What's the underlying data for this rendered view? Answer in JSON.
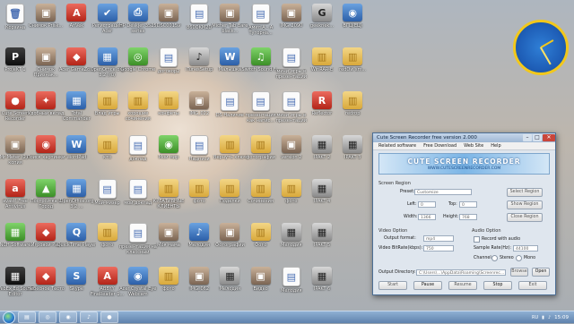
{
  "desktop": {
    "icons": [
      {
        "label": "Корзина",
        "glyph": "🗑",
        "kind": "doc",
        "col": 0,
        "row": 0
      },
      {
        "label": "Снимок Prisk...",
        "glyph": "▣",
        "kind": "photo",
        "col": 1,
        "row": 0
      },
      {
        "label": "AnVek",
        "glyph": "A",
        "kind": "red",
        "col": 2,
        "row": 0
      },
      {
        "label": "Регистрация Acer",
        "glyph": "✔",
        "kind": "app",
        "col": 3,
        "row": 0
      },
      {
        "label": "HP Deskjet 3525 series",
        "glyph": "⎙",
        "kind": "app",
        "col": 4,
        "row": 0
      },
      {
        "label": "DSC00159",
        "glyph": "▣",
        "kind": "photo",
        "col": 5,
        "row": 0
      },
      {
        "label": "860OKM2D",
        "glyph": "▤",
        "kind": "doc",
        "col": 6,
        "row": 0
      },
      {
        "label": "Micher Tab Bare black...",
        "glyph": "▣",
        "kind": "photo",
        "col": 7,
        "row": 0
      },
      {
        "label": "Амил А - A Туторна...",
        "glyph": "▤",
        "kind": "doc",
        "col": 8,
        "row": 0
      },
      {
        "label": "IMG_2090",
        "glyph": "▣",
        "kind": "photo",
        "col": 9,
        "row": 0
      },
      {
        "label": "geeknek...",
        "glyph": "G",
        "kind": "film",
        "col": 10,
        "row": 0
      },
      {
        "label": "ВГЦ(ЕЦ)",
        "glyph": "◉",
        "kind": "app",
        "col": 11,
        "row": 0
      },
      {
        "label": "ProjeKT 1",
        "glyph": "P",
        "kind": "dark",
        "col": 0,
        "row": 1
      },
      {
        "label": "Снимок Признак...",
        "glyph": "▣",
        "kind": "photo",
        "col": 1,
        "row": 1
      },
      {
        "label": "Acer GameZo...",
        "glyph": "◆",
        "kind": "red",
        "col": 2,
        "row": 1
      },
      {
        "label": "OpenOffice.org 3.2 (ru)",
        "glyph": "▦",
        "kind": "app",
        "col": 3,
        "row": 1
      },
      {
        "label": "Google Chrome",
        "glyph": "◎",
        "kind": "green",
        "col": 4,
        "row": 1
      },
      {
        "label": "договор2",
        "glyph": "▤",
        "kind": "doc",
        "col": 5,
        "row": 1
      },
      {
        "label": "iTunesSetup",
        "glyph": "♪",
        "kind": "film",
        "col": 6,
        "row": 1
      },
      {
        "label": "Малышка",
        "glyph": "W",
        "kind": "app",
        "col": 7,
        "row": 1
      },
      {
        "label": "Switch Sound F...",
        "glyph": "♫",
        "kind": "green",
        "col": 8,
        "row": 1
      },
      {
        "label": "мини игры в презентации",
        "glyph": "▤",
        "kind": "doc",
        "col": 9,
        "row": 1
      },
      {
        "label": "WinRAR-E",
        "glyph": "▥",
        "kind": "folder",
        "col": 10,
        "row": 1
      },
      {
        "label": "redOw sm...",
        "glyph": "▥",
        "kind": "folder",
        "col": 11,
        "row": 1
      },
      {
        "label": "Cute Screen Recorder",
        "glyph": "●",
        "kind": "red",
        "col": 0,
        "row": 2
      },
      {
        "label": "Удобный вклад",
        "glyph": "✦",
        "kind": "red",
        "col": 1,
        "row": 2
      },
      {
        "label": "Total Commander",
        "glyph": "▦",
        "kind": "app",
        "col": 2,
        "row": 2
      },
      {
        "label": "Влад игры",
        "glyph": "▥",
        "kind": "folder",
        "col": 3,
        "row": 2
      },
      {
        "label": "хорошие сочинения",
        "glyph": "▥",
        "kind": "folder",
        "col": 4,
        "row": 2
      },
      {
        "label": "конфеты",
        "glyph": "▥",
        "kind": "folder",
        "col": 5,
        "row": 2
      },
      {
        "label": "IMG_022",
        "glyph": "▣",
        "kind": "photo",
        "col": 6,
        "row": 2
      },
      {
        "label": "DS Наличие",
        "glyph": "▤",
        "kind": "doc",
        "col": 7,
        "row": 2
      },
      {
        "label": "презентация как напис...",
        "glyph": "▤",
        "kind": "doc",
        "col": 8,
        "row": 2
      },
      {
        "label": "мини игры в презентации",
        "glyph": "▤",
        "kind": "doc",
        "col": 9,
        "row": 2
      },
      {
        "label": "Reflector",
        "glyph": "R",
        "kind": "red",
        "col": 10,
        "row": 2
      },
      {
        "label": "redrop",
        "glyph": "▥",
        "kind": "folder",
        "col": 11,
        "row": 2
      },
      {
        "label": "Mr Meter (2) - копия",
        "glyph": "▣",
        "kind": "photo",
        "col": 0,
        "row": 3
      },
      {
        "label": "Поиск картинки",
        "glyph": "◉",
        "kind": "red",
        "col": 1,
        "row": 3
      },
      {
        "label": "WordPad",
        "glyph": "W",
        "kind": "app",
        "col": 2,
        "row": 3
      },
      {
        "label": "кто",
        "glyph": "▥",
        "kind": "folder",
        "col": 3,
        "row": 3
      },
      {
        "label": "доклад",
        "glyph": "▤",
        "kind": "doc",
        "col": 4,
        "row": 3
      },
      {
        "label": "Мой мир",
        "glyph": "◉",
        "kind": "green",
        "col": 5,
        "row": 3
      },
      {
        "label": "Надписи",
        "glyph": "▤",
        "kind": "doc",
        "col": 6,
        "row": 3
      },
      {
        "label": "Вернуть ключ",
        "glyph": "▥",
        "kind": "folder",
        "col": 7,
        "row": 3
      },
      {
        "label": "фотографии",
        "glyph": "▥",
        "kind": "folder",
        "col": 8,
        "row": 3
      },
      {
        "label": "version 2",
        "glyph": "▣",
        "kind": "photo",
        "col": 9,
        "row": 3
      },
      {
        "label": "IPAKT 2",
        "glyph": "▦",
        "kind": "film",
        "col": 10,
        "row": 3
      },
      {
        "label": "IPAKT 3",
        "glyph": "▦",
        "kind": "film",
        "col": 11,
        "row": 3
      },
      {
        "label": "avast! Free Antivirus",
        "glyph": "a",
        "kind": "red",
        "col": 0,
        "row": 4
      },
      {
        "label": "Построй-ка 2 Город",
        "glyph": "▲",
        "kind": "green",
        "col": 1,
        "row": 4
      },
      {
        "label": "OpenOffice.org 3.2 ...",
        "glyph": "▦",
        "kind": "app",
        "col": 2,
        "row": 4
      },
      {
        "label": "Мой-мизер",
        "glyph": "▤",
        "kind": "doc",
        "col": 3,
        "row": 4
      },
      {
        "label": "мой доклад",
        "glyph": "▤",
        "kind": "doc",
        "col": 4,
        "row": 4
      },
      {
        "label": "КРЕАТИВНЫЕ КЛИЕНТЫ",
        "glyph": "▥",
        "kind": "folder",
        "col": 5,
        "row": 4
      },
      {
        "label": "фото",
        "glyph": "▥",
        "kind": "folder",
        "col": 6,
        "row": 4
      },
      {
        "label": "Поделки",
        "glyph": "▥",
        "kind": "folder",
        "col": 7,
        "row": 4
      },
      {
        "label": "Сочинения",
        "glyph": "▥",
        "kind": "folder",
        "col": 8,
        "row": 4
      },
      {
        "label": "фото",
        "glyph": "▥",
        "kind": "folder",
        "col": 9,
        "row": 4
      },
      {
        "label": "IPAKT 4",
        "glyph": "▦",
        "kind": "film",
        "col": 10,
        "row": 4
      },
      {
        "label": "NCH Software",
        "glyph": "▦",
        "kind": "green",
        "col": 0,
        "row": 5
      },
      {
        "label": "Игровой Рай",
        "glyph": "◆",
        "kind": "red",
        "col": 1,
        "row": 5
      },
      {
        "label": "QuickTime Player",
        "glyph": "Q",
        "kind": "app",
        "col": 2,
        "row": 5
      },
      {
        "label": "фото",
        "glyph": "▥",
        "kind": "folder",
        "col": 3,
        "row": 5
      },
      {
        "label": "презентация на классный",
        "glyph": "▤",
        "kind": "doc",
        "col": 4,
        "row": 5
      },
      {
        "label": "Моя мама",
        "glyph": "▣",
        "kind": "photo",
        "col": 5,
        "row": 5
      },
      {
        "label": "Мелодия",
        "glyph": "♪",
        "kind": "app",
        "col": 6,
        "row": 5
      },
      {
        "label": "Фотографии",
        "glyph": "▣",
        "kind": "photo",
        "col": 7,
        "row": 5
      },
      {
        "label": "Фото",
        "glyph": "▥",
        "kind": "folder",
        "col": 8,
        "row": 5
      },
      {
        "label": "Мелодия",
        "glyph": "▦",
        "kind": "film",
        "col": 9,
        "row": 5
      },
      {
        "label": "IPAKT 5",
        "glyph": "▦",
        "kind": "film",
        "col": 10,
        "row": 5
      },
      {
        "label": "WebEx Ed Sound Editor",
        "glyph": "▦",
        "kind": "dark",
        "col": 0,
        "row": 6
      },
      {
        "label": "Небесное Тесто",
        "glyph": "◆",
        "kind": "red",
        "col": 1,
        "row": 6
      },
      {
        "label": "Skype",
        "glyph": "S",
        "kind": "app",
        "col": 2,
        "row": 6
      },
      {
        "label": "ABBYY FineReader 1...",
        "glyph": "A",
        "kind": "red",
        "col": 3,
        "row": 6
      },
      {
        "label": "Acer Crystal Eye Webcam",
        "glyph": "◉",
        "kind": "app",
        "col": 4,
        "row": 6
      },
      {
        "label": "фото",
        "glyph": "▥",
        "kind": "folder",
        "col": 5,
        "row": 6
      },
      {
        "label": "IMG_062",
        "glyph": "▣",
        "kind": "photo",
        "col": 6,
        "row": 6
      },
      {
        "label": "Мелодия",
        "glyph": "▦",
        "kind": "film",
        "col": 7,
        "row": 6
      },
      {
        "label": "Видео",
        "glyph": "▣",
        "kind": "photo",
        "col": 8,
        "row": 6
      },
      {
        "label": "Мелодия",
        "glyph": "▤",
        "kind": "doc",
        "col": 9,
        "row": 6
      },
      {
        "label": "IPAKT 6",
        "glyph": "▦",
        "kind": "film",
        "col": 10,
        "row": 6
      }
    ]
  },
  "window": {
    "title": "Cute Screen Recorder free version 2.000",
    "menu": [
      "Related software",
      "Free Download",
      "Web Site",
      "Help"
    ],
    "banner_title": "CUTE SCREEN RECORDER",
    "banner_subtitle": "WWW.CUTESCREENRECORDER.COM",
    "screen_region": {
      "label": "Screen Region",
      "preset_label": "Preset:",
      "preset_value": "Customize",
      "left_label": "Left:",
      "left_value": "0",
      "top_label": "Top:",
      "top_value": "0",
      "width_label": "Width:",
      "width_value": "1366",
      "height_label": "Height:",
      "height_value": "768",
      "select_region": "Select Region",
      "show_region": "Show Region",
      "close_region": "Close Region"
    },
    "video_option": {
      "label": "Video Option",
      "output_format_label": "Output format:",
      "output_format_value": "mp4",
      "bitrate_label": "Video BitRate(kbps):",
      "bitrate_value": "750"
    },
    "audio_option": {
      "label": "Audio Option",
      "record_audio_label": "Record with audio",
      "sample_rate_label": "Sample Rate(Hz):",
      "sample_rate_value": "44100",
      "channel_label": "Channel:",
      "stereo_label": "Stereo",
      "mono_label": "Mono"
    },
    "output": {
      "label": "Output Directory:",
      "value": "C:\\Users\\...\\AppData\\Roaming\\Screenrec...",
      "browse": "Browse",
      "open": "Open"
    },
    "buttons": {
      "start": "Start",
      "pause": "Pause",
      "resume": "Resume",
      "stop": "Stop",
      "exit": "Exit"
    }
  },
  "taskbar": {
    "apps": [
      "▤",
      "◎",
      "◉",
      "♪",
      "●"
    ],
    "tray_lang": "RU",
    "time": "15:09"
  },
  "clock_gadget": {
    "hour_angle": -30,
    "minute_angle": 60
  }
}
